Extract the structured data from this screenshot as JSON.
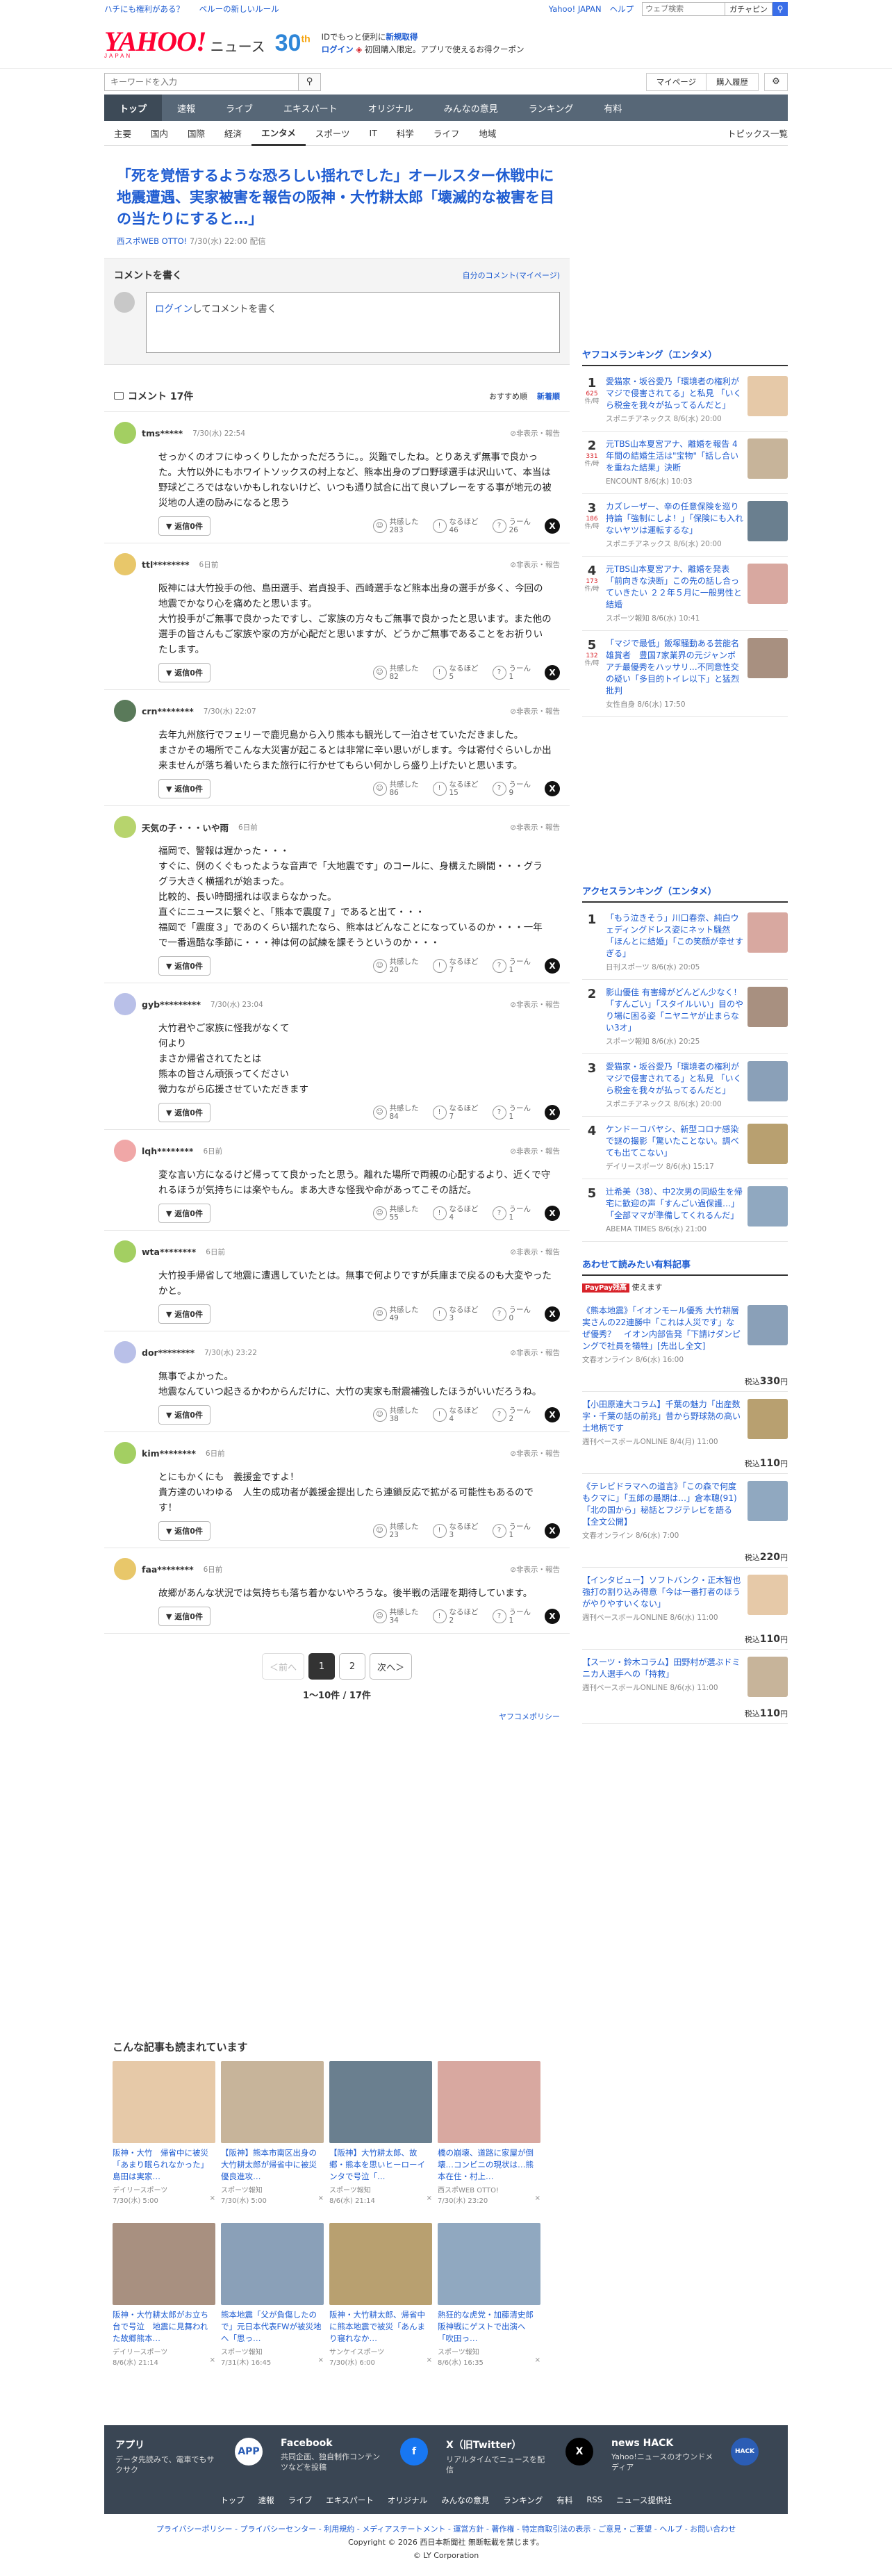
{
  "topstrip": {
    "links": [
      "ハチにも権利がある？",
      "ベルーの新しいルール"
    ],
    "yahoo_japan": "Yahoo! JAPAN",
    "help": "ヘルプ",
    "search_placeholder": "ウェブ検索",
    "gachabtn": "ガチャピン"
  },
  "header": {
    "logo": "YAHOO!",
    "logo_sub": "JAPAN",
    "news": "ニュース",
    "anniv": "30",
    "anniv_sup": "th",
    "login_line1a": "IDでもっと便利に",
    "login_line1b": "新規取得",
    "login_line2a": "ログイン",
    "login_line2b": "初回購入限定。アプリで使えるお得クーポン"
  },
  "search": {
    "placeholder": "キーワードを入力",
    "mypage": "マイページ",
    "history": "購入履歴"
  },
  "nav": [
    "トップ",
    "速報",
    "ライブ",
    "エキスパート",
    "オリジナル",
    "みんなの意見",
    "ランキング",
    "有料"
  ],
  "subnav": {
    "items": [
      "主要",
      "国内",
      "国際",
      "経済",
      "エンタメ",
      "スポーツ",
      "IT",
      "科学",
      "ライフ",
      "地域"
    ],
    "topics": "トピックス一覧"
  },
  "article": {
    "title": "「死を覚悟するような恐ろしい揺れでした」オールスター休戦中に地震遭遇、実家被害を報告の阪神・大竹耕太郎「壊滅的な被害を目の当たりにすると…」",
    "source": "西スポWEB OTTO!",
    "date": "7/30(水) 22:00 配信"
  },
  "comment_box": {
    "title": "コメントを書く",
    "mine": "自分のコメント(マイページ)",
    "prompt_link": "ログイン",
    "prompt_rest": "してコメントを書く"
  },
  "list": {
    "title": "コメント 17件",
    "sort_rec": "おすすめ順",
    "sort_new": "新着順"
  },
  "common": {
    "reply": "返信0件",
    "flags": "非表示・報告",
    "empathy": "共感した",
    "naruhodo": "なるほど",
    "uun": "うーん"
  },
  "comments": [
    {
      "name": "tms*****",
      "time": "7/30(水) 22:54",
      "body": "せっかくのオフにゆっくりしたかっただろうに。。災難でしたね。とりあえず無事で良かった。大竹以外にもホワイトソックスの村上など、熊本出身のプロ野球選手は沢山いて、本当は野球どころではないかもしれないけど、いつも通り試合に出て良いプレーをする事が地元の被災地の人達の励みになると思う",
      "e": "283",
      "n": "46",
      "u": "26"
    },
    {
      "name": "ttl********",
      "time": "6日前",
      "body": "阪神には大竹投手の他、島田選手、岩貞投手、西崎選手など熊本出身の選手が多く、今回の地震でかなり心を痛めたと思います。\n大竹投手がご無事で良かったですし、ご家族の方々もご無事で良かったと思います。また他の選手の皆さんもご家族や家の方が心配だと思いますが、どうかご無事であることをお祈りいたします。",
      "e": "82",
      "n": "5",
      "u": "1"
    },
    {
      "name": "crn********",
      "time": "7/30(水) 22:07",
      "body": "去年九州旅行でフェリーで鹿児島から入り熊本も観光して一泊させていただきました。\nまさかその場所でこんな大災害が起こるとは非常に辛い思いがします。今は寄付ぐらいしか出来ませんが落ち着いたらまた旅行に行かせてもらい何かしら盛り上げたいと思います。",
      "e": "86",
      "n": "15",
      "u": "9"
    },
    {
      "name": "天気の子・・・いや雨",
      "time": "6日前",
      "body": "福岡で、警報は遅かった・・・\nすぐに、例のくぐもったような音声で「大地震です」のコールに、身構えた瞬間・・・グラグラ大きく横揺れが始まった。\n比較的、長い時間揺れは収まらなかった。\n直ぐにニュースに繋ぐと、「熊本で震度７」であると出て・・・\n福岡で「震度３」であのくらい揺れたなら、熊本はどんなことになっているのか・・・一年で一番過酷な季節に・・・神は何の試練を課そうというのか・・・",
      "e": "20",
      "n": "7",
      "u": "1"
    },
    {
      "name": "gyb*********",
      "time": "7/30(水) 23:04",
      "body": "大竹君やご家族に怪我がなくて\n何より\nまさか帰省されてたとは\n熊本の皆さん頑張ってください\n微力ながら応援させていただきます",
      "e": "84",
      "n": "7",
      "u": "1"
    },
    {
      "name": "lqh********",
      "time": "6日前",
      "body": "変な言い方になるけど帰ってて良かったと思う。離れた場所で両親の心配するより、近くで守れるほうが気持ちには楽やもん。まあ大きな怪我や命があってこその話だ。",
      "e": "55",
      "n": "4",
      "u": "1"
    },
    {
      "name": "wta********",
      "time": "6日前",
      "body": "大竹投手帰省して地震に遭遇していたとは。無事で何よりですが兵庫まで戻るのも大変やったかと。",
      "e": "49",
      "n": "3",
      "u": "0"
    },
    {
      "name": "dor********",
      "time": "7/30(水) 23:22",
      "body": "無事でよかった。\n地震なんていつ起きるかわからんだけに、大竹の実家も耐震補強したほうがいいだろうね。",
      "e": "38",
      "n": "4",
      "u": "2"
    },
    {
      "name": "kim********",
      "time": "6日前",
      "body": "とにもかくにも　義援金ですよ！\n貴方達のいわゆる　人生の成功者が義援金提出したら連鎖反応で拡がる可能性もあるのです！",
      "e": "23",
      "n": "3",
      "u": "1"
    },
    {
      "name": "faa********",
      "time": "6日前",
      "body": "故郷があんな状況では気持ちも落ち着かないやろうな。後半戦の活躍を期待しています。",
      "e": "34",
      "n": "2",
      "u": "1"
    }
  ],
  "pager": {
    "prev": "＜前へ",
    "p1": "1",
    "p2": "2",
    "next": "次へ＞",
    "info": "1〜10件 / 17件"
  },
  "policy": "ヤフコメポリシー",
  "side_rank": {
    "title": "ヤフコメランキング（エンタメ）",
    "unit": "件/時",
    "items": [
      {
        "n": "1",
        "c": "625",
        "t": "愛猫家・坂谷愛乃「環境者の権利がマジで侵害されてる」と私見 「いくら税金を我々が払ってるんだと」",
        "s": "スポニチアネックス",
        "d": "8/6(水) 20:00"
      },
      {
        "n": "2",
        "c": "331",
        "t": "元TBS山本夏宮アナ、離婚を報告 4年間の結婚生活は\"宝物\"「話し合いを重ねた結果」決断",
        "s": "ENCOUNT",
        "d": "8/6(水) 10:03"
      },
      {
        "n": "3",
        "c": "186",
        "t": "カズレーザー、辛の任意保険を巡り持論「強制にしよ！」「保険にも入れないヤツは運転するな」",
        "s": "スポニチアネックス",
        "d": "8/6(水) 20:00"
      },
      {
        "n": "4",
        "c": "173",
        "t": "元TBS山本夏宮アナ、離婚を発表「前向きな決断」この先の話し合っていきたい ２２年５月に一般男性と結婚",
        "s": "スポーツ報知",
        "d": "8/6(水) 10:41"
      },
      {
        "n": "5",
        "c": "132",
        "t": "「マジで最低」飯塚騒動ある芸能名雄賞者　豊国7家業界の元ジャンボアチ最優秀をハッサリ…不同意性交の疑い「多目的トイレ以下」と猛烈批判",
        "s": "女性自身",
        "d": "8/6(水) 17:50"
      }
    ]
  },
  "side_access": {
    "title": "アクセスランキング（エンタメ）",
    "items": [
      {
        "n": "1",
        "t": "「もう泣きそう」川口春奈、純白ウェディングドレス姿にネット騒然「ほんとに結婚」「この笑顔が幸せすぎる」",
        "s": "日刊スポーツ",
        "d": "8/6(水) 20:05"
      },
      {
        "n": "2",
        "t": "影山優佳 有害縁がどんどん少なく！「すんごい」「スタイルいい」目のやり場に困る姿「ニヤニヤが止まらない3オ」",
        "s": "スポーツ報知",
        "d": "8/6(水) 20:25"
      },
      {
        "n": "3",
        "t": "愛猫家・坂谷愛乃「環境者の権利がマジで侵害されてる」と私見 「いくら税金を我々が払ってるんだと」",
        "s": "スポニチアネックス",
        "d": "8/6(水) 20:00"
      },
      {
        "n": "4",
        "t": "ケンドーコバヤシ、新型コロナ感染で謎の撮影「驚いたことない。調べても出てこない」",
        "s": "デイリースポーツ",
        "d": "8/6(水) 15:17"
      },
      {
        "n": "5",
        "t": "辻希美（38）、中2次男の同級生を帰宅に歓迎の声「すんごい過保護…」「全部ママが準備してくれるんだ」",
        "s": "ABEMA TIMES",
        "d": "8/6(水) 21:00"
      }
    ]
  },
  "paid": {
    "title": "あわせて読みたい有料記事",
    "pp_label": "PayPay残高",
    "pp_rest": "使えます",
    "yen": "税込",
    "items": [
      {
        "t": "《熊本地震》「イオンモール優秀 大竹耕層実さんの22連勝中「これは人災です」なぜ優秀？　イオン内部告発「下請けダンピングで社員を犠牲」[先出し全文]",
        "s": "文春オンライン",
        "d": "8/6(水) 16:00",
        "p": "330"
      },
      {
        "t": "【小田原達大コラム】千葉の魅力「出産数字・千葉の話の前兆」昔から野球熱の高い土地柄です",
        "s": "週刊ベースボールONLINE",
        "d": "8/4(月) 11:00",
        "p": "110"
      },
      {
        "t": "《テレビドラマへの道言》「この森で何度もクマに」「五郎の最期は…」倉本聰(91)「北の国から」秘話とフジテレビを語る【全文公開】",
        "s": "文春オンライン",
        "d": "8/6(水) 7:00",
        "p": "220"
      },
      {
        "t": "【インタビュー】ソフトバンク・正木智也　強打の割り込み得意「今は一番打者のほうがやりやすいくない」",
        "s": "週刊ベースボールONLINE",
        "d": "8/6(水) 11:00",
        "p": "110"
      },
      {
        "t": "【スーツ・鈴木コラム】田野村が選ぶドミニカ人選手への「持救」",
        "s": "週刊ベースボールONLINE",
        "d": "8/6(水) 11:00",
        "p": "110"
      }
    ]
  },
  "also": {
    "title": "こんな記事も読まれています",
    "items": [
      {
        "t": "阪神・大竹　帰省中に被災「あまり眠られなかった」　島田は実家…",
        "s": "デイリースポーツ",
        "d": "7/30(水) 5:00"
      },
      {
        "t": "【阪神】熊本市南区出身の大竹耕太郎が帰省中に被災　優良進攻…",
        "s": "スポーツ報知",
        "d": "7/30(水) 5:00"
      },
      {
        "t": "【阪神】大竹耕太郎、故郷・熊本を思いヒーローインタで号泣「…",
        "s": "スポーツ報知",
        "d": "8/6(水) 21:14"
      },
      {
        "t": "橋の崩壊、道路に家屋が倒壊…コンビニの現状は…熊本在住・村上…",
        "s": "西スポWEB OTTO!",
        "d": "7/30(水) 23:20"
      },
      {
        "t": "阪神・大竹耕太郎がお立ち台で号泣　地震に見舞われた故郷熊本…",
        "s": "デイリースポーツ",
        "d": "8/6(水) 21:14"
      },
      {
        "t": "熊本地震「父が負傷したので」元日本代表FWが被災地へ「思っ…",
        "s": "スポーツ報知",
        "d": "7/31(木) 16:45"
      },
      {
        "t": "阪神・大竹耕太郎、帰省中に熊本地震で被災「あんまり寝れなか…",
        "s": "サンケイスポーツ",
        "d": "7/30(水) 6:00"
      },
      {
        "t": "熱狂的な虎党・加藤清史郎　阪神戦にゲストで出演へ「吹田っ…",
        "s": "スポーツ報知",
        "d": "8/6(水) 16:35"
      }
    ]
  },
  "footer": {
    "cols": [
      {
        "t": "アプリ",
        "d": "データ先読みで、電車でもサクサク",
        "i": "APP"
      },
      {
        "t": "Facebook",
        "d": "共同企画、独自制作コンテンツなどを投稿",
        "i": "f"
      },
      {
        "t": "X（旧Twitter）",
        "d": "リアルタイムでニュースを配信",
        "i": "X"
      },
      {
        "t": "news HACK",
        "d": "Yahoo!ニュースのオウンドメディア",
        "i": "HACK"
      }
    ],
    "links": [
      "トップ",
      "速報",
      "ライブ",
      "エキスパート",
      "オリジナル",
      "みんなの意見",
      "ランキング",
      "有料",
      "RSS",
      "ニュース提供社"
    ],
    "legal": "プライバシーポリシー - プライバシーセンター - 利用規約 - メディアステートメント - 運営方針 - 著作権 - 特定商取引法の表示 - ご意見・ご要望 - ヘルプ - お問い合わせ",
    "copy1": "Copyright © 2026 西日本新聞社 無断転載を禁じます。",
    "copy2": "© LY Corporation"
  }
}
